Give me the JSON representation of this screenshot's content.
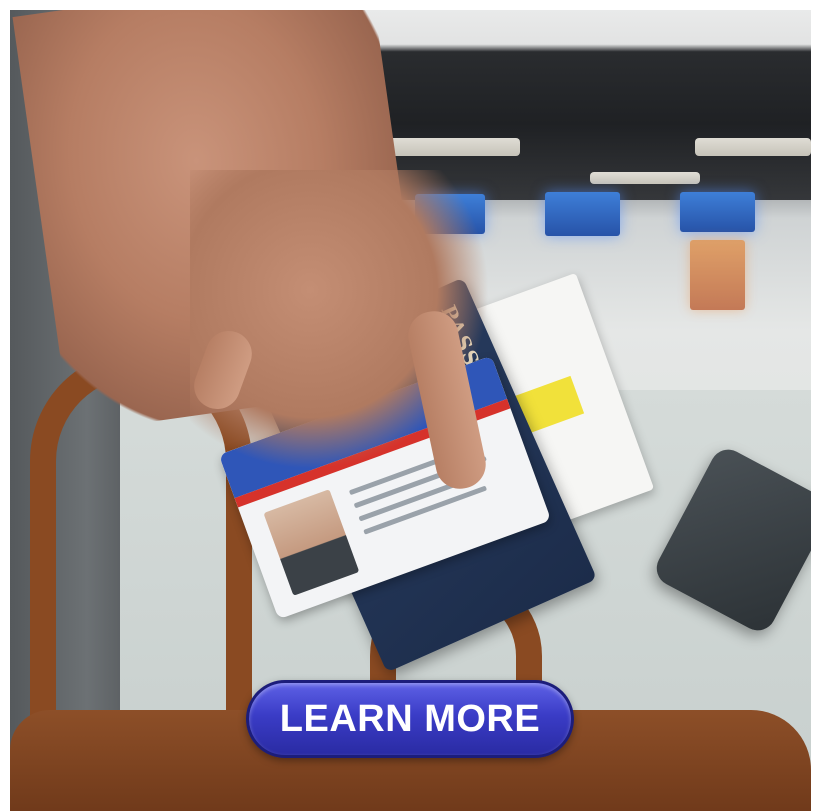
{
  "banner": {
    "passport_label": "PASSPORT",
    "cta_label": "LEARN MORE",
    "cta_color": "#3a3cc6"
  }
}
